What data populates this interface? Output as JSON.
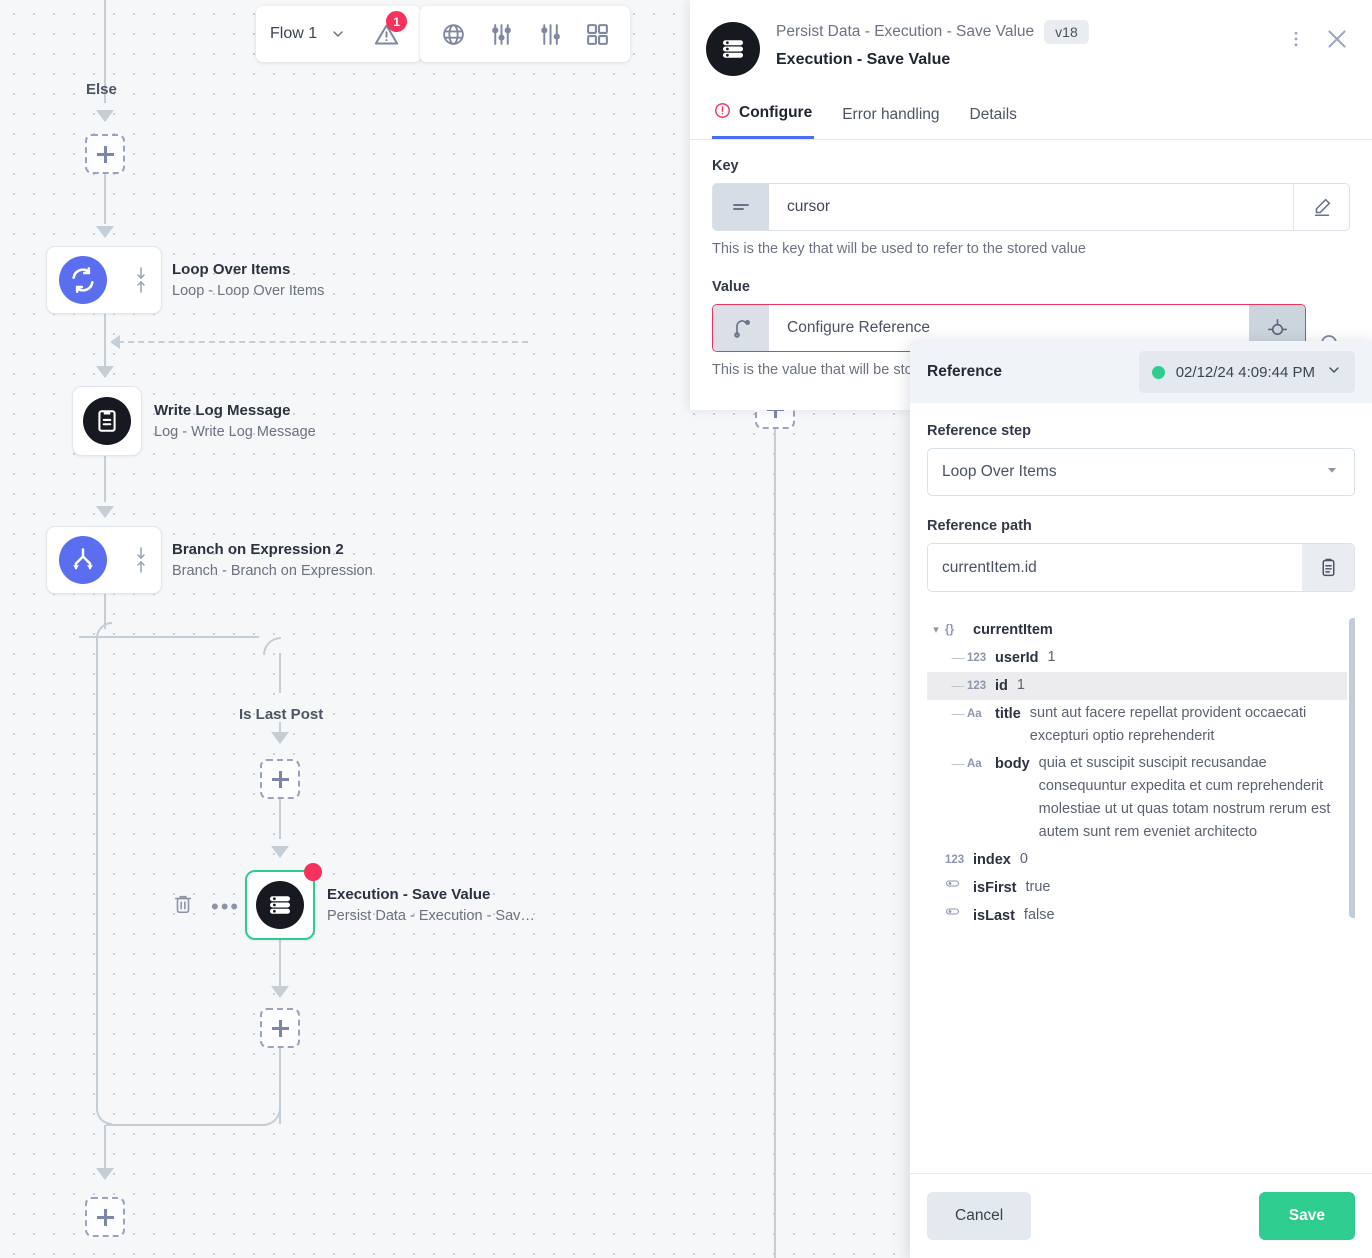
{
  "toolbar": {
    "flow_name": "Flow 1",
    "flow_caret": "chevron-down",
    "warning_badge": "1",
    "icons": [
      "globe-icon",
      "sliders-icon",
      "sliders-alt-icon",
      "grid-icon"
    ]
  },
  "canvas": {
    "branch_labels": [
      {
        "text": "Else"
      },
      {
        "text": "Is Last Post"
      }
    ],
    "nodes": [
      {
        "title": "Loop Over Items",
        "subtitle": "Loop - Loop Over Items",
        "icon": "loop-icon",
        "accent": "#5b6ef0"
      },
      {
        "title": "Write Log Message",
        "subtitle": "Log - Write Log Message",
        "icon": "log-icon",
        "accent": "#161a20"
      },
      {
        "title": "Branch on Expression 2",
        "subtitle": "Branch - Branch on Expression",
        "icon": "branch-icon",
        "accent": "#5b6ef0"
      },
      {
        "title": "Execution - Save Value",
        "subtitle": "Persist Data - Execution - Sav…",
        "icon": "persist-icon",
        "accent": "#161a20"
      }
    ],
    "selected_node_index": 3,
    "add_buttons": 4
  },
  "panel": {
    "superscript": "Persist Data - Execution - Save Value",
    "version": "v18",
    "title": "Execution - Save Value",
    "more_icon": "kebab-menu-icon",
    "close_icon": "close-icon",
    "tabs": [
      {
        "label": "Configure",
        "active": true,
        "status_icon": "error-circle-icon"
      },
      {
        "label": "Error handling",
        "active": false,
        "status_icon": ""
      },
      {
        "label": "Details",
        "active": false,
        "status_icon": ""
      }
    ],
    "key_field": {
      "label": "Key",
      "value": "cursor",
      "help": "This is the key that will be used to refer to the stored value",
      "type_icon": "text-lines-icon",
      "edit_icon": "pencil-icon"
    },
    "value_field": {
      "label": "Value",
      "value": "Configure Reference",
      "help": "This is the value that will be stor",
      "type_icon": "reference-arrow-icon",
      "action_icon": "reference-target-icon",
      "extra_icon": "magnifier-icon"
    }
  },
  "reference_popover": {
    "title": "Reference",
    "run_selector": {
      "status_color": "#2ecc8f",
      "timestamp": "02/12/24 4:09:44 PM",
      "caret": "chevron-down"
    },
    "step": {
      "label": "Reference step",
      "value": "Loop Over Items"
    },
    "path": {
      "label": "Reference path",
      "value": "currentItem.id",
      "copy_icon": "clipboard-icon"
    },
    "tree": [
      {
        "depth": 0,
        "type": "object",
        "type_icon": "{}",
        "key": "currentItem",
        "value": "",
        "expanded": true,
        "highlighted": false
      },
      {
        "depth": 1,
        "type": "number",
        "type_icon": "123",
        "key": "userId",
        "value": "1",
        "highlighted": false
      },
      {
        "depth": 1,
        "type": "number",
        "type_icon": "123",
        "key": "id",
        "value": "1",
        "highlighted": true
      },
      {
        "depth": 1,
        "type": "string",
        "type_icon": "Aa",
        "key": "title",
        "value": "sunt aut facere repellat provident occaecati excepturi optio reprehenderit",
        "highlighted": false
      },
      {
        "depth": 1,
        "type": "string",
        "type_icon": "Aa",
        "key": "body",
        "value": "quia et suscipit suscipit recusandae consequuntur expedita et cum reprehenderit molestiae ut ut quas totam nostrum rerum est autem sunt rem eveniet architecto",
        "highlighted": false
      },
      {
        "depth": 0,
        "type": "number",
        "type_icon": "123",
        "key": "index",
        "value": "0",
        "highlighted": false
      },
      {
        "depth": 0,
        "type": "boolean",
        "type_icon": "toggle",
        "key": "isFirst",
        "value": "true",
        "highlighted": false
      },
      {
        "depth": 0,
        "type": "boolean",
        "type_icon": "toggle",
        "key": "isLast",
        "value": "false",
        "highlighted": false
      }
    ],
    "cancel_label": "Cancel",
    "save_label": "Save"
  },
  "colors": {
    "accent_blue": "#4a6cf7",
    "node_blue": "#5b6ef0",
    "green": "#2ecc8f",
    "red": "#f5325b",
    "canvas_bg": "#f5f7f9"
  }
}
